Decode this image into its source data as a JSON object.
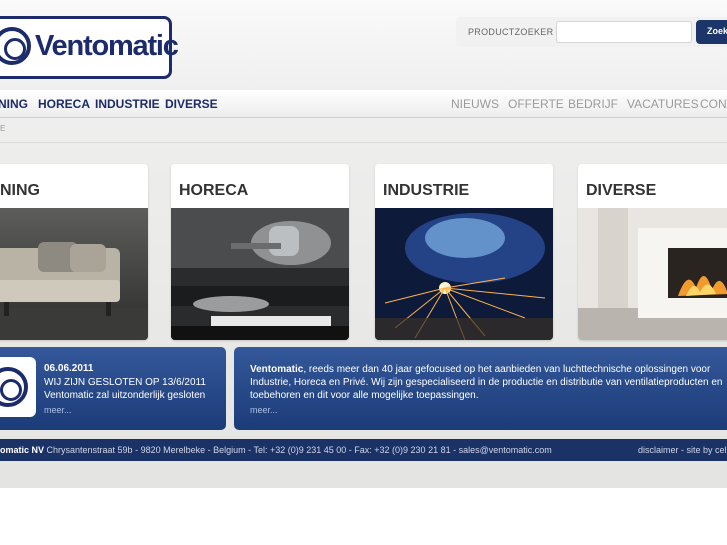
{
  "brand": {
    "name": "Ventomatic",
    "color": "#1b2b6b"
  },
  "search": {
    "label": "PRODUCTZOEKER",
    "value": "",
    "button": "Zoek"
  },
  "nav": {
    "main": [
      "NING",
      "HORECA",
      "INDUSTRIE",
      "DIVERSE"
    ],
    "secondary": [
      "NIEUWS",
      "OFFERTE",
      "BEDRIJF",
      "VACATURES",
      "CONT"
    ]
  },
  "breadcrumb": "E",
  "categories": [
    {
      "title": "NING"
    },
    {
      "title": "HORECA"
    },
    {
      "title": "INDUSTRIE"
    },
    {
      "title": "DIVERSE"
    }
  ],
  "news": {
    "date": "06.06.2011",
    "line1": "WIJ ZIJN GESLOTEN OP 13/6/2011",
    "line2": "Ventomatic zal uitzonderlijk gesloten",
    "more": "meer..."
  },
  "about": {
    "lead": "Ventomatic",
    "text": ", reeds meer dan 40 jaar gefocused op het aanbieden van luchttechnische oplossingen voor Industrie, Horeca en Privé. Wij zijn gespecialiseerd in de productie en distributie van ventilatieproducten en toebehoren en dit voor alle mogelijke toepassingen.",
    "more": "meer..."
  },
  "footer": {
    "company": "omatic NV",
    "address": " Chrysantenstraat 59b - 9820 Merelbeke - Belgium - Tel: +32 (0)9 231 45 00 - Fax: +32 (0)9 230 21 81 - sales@ventomatic.com",
    "links": "disclaimer - site by cel"
  }
}
